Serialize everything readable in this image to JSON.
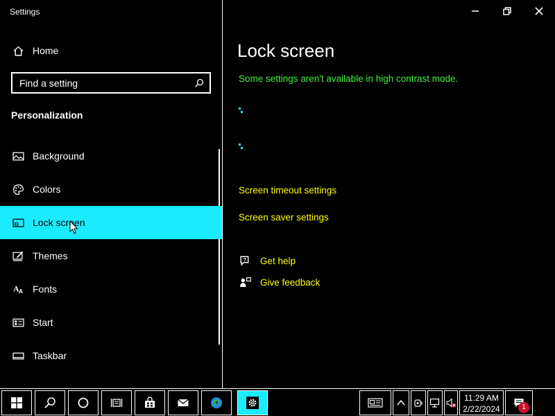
{
  "window": {
    "title": "Settings",
    "minimize_icon": "minimize-icon",
    "restore_icon": "restore-icon",
    "close_icon": "close-icon"
  },
  "sidebar": {
    "home_label": "Home",
    "search_placeholder": "Find a setting",
    "section_title": "Personalization",
    "items": [
      {
        "label": "Background",
        "icon": "background-icon"
      },
      {
        "label": "Colors",
        "icon": "palette-icon"
      },
      {
        "label": "Lock screen",
        "icon": "lock-screen-icon",
        "selected": true
      },
      {
        "label": "Themes",
        "icon": "themes-icon"
      },
      {
        "label": "Fonts",
        "icon": "fonts-icon"
      },
      {
        "label": "Start",
        "icon": "start-icon"
      },
      {
        "label": "Taskbar",
        "icon": "taskbar-icon"
      }
    ]
  },
  "main": {
    "title": "Lock screen",
    "notice": "Some settings aren't available in high contrast mode.",
    "links": [
      "Screen timeout settings",
      "Screen saver settings"
    ],
    "help": {
      "get_help": "Get help",
      "give_feedback": "Give feedback"
    }
  },
  "taskbar": {
    "time": "11:29 AM",
    "date": "2/22/2024",
    "notification_count": "1"
  },
  "colors": {
    "accent": "#1aebff",
    "notice": "#3ff23f",
    "link": "#ffff00",
    "background": "#000000",
    "badge": "#c8102e"
  }
}
